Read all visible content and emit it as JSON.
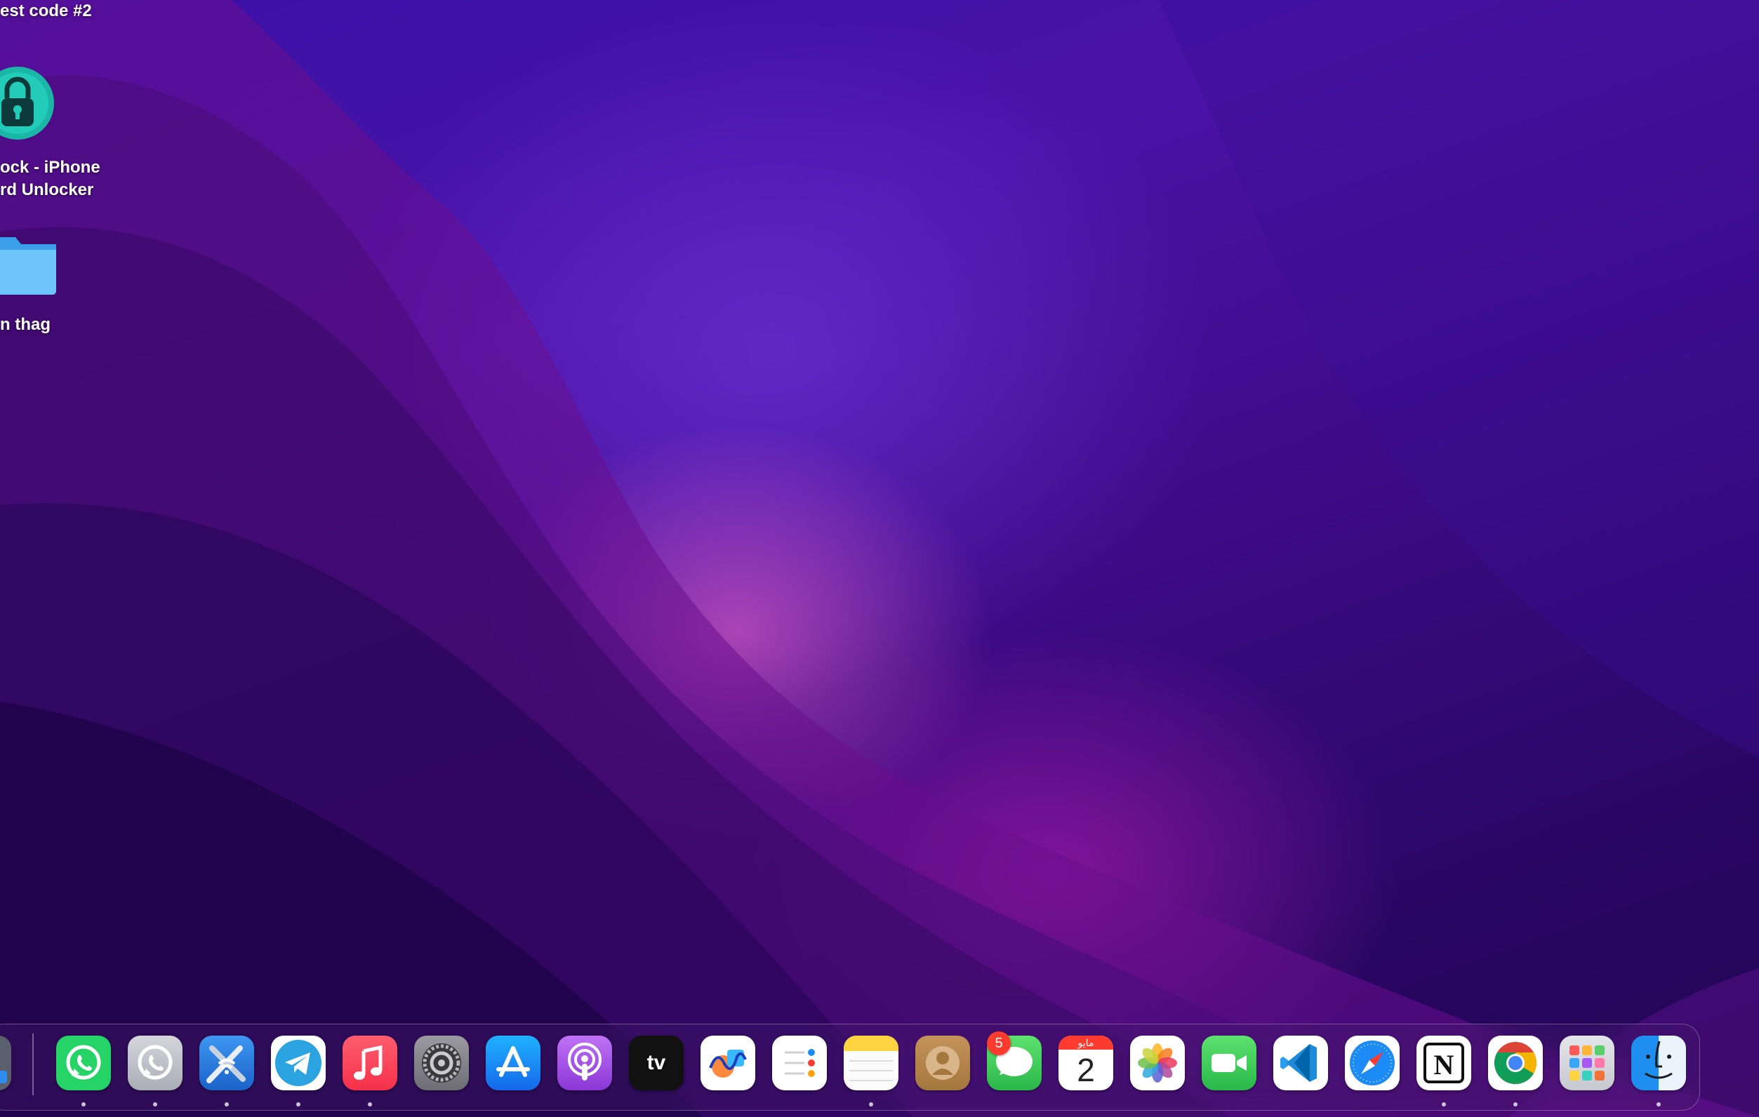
{
  "desktop": {
    "items": [
      {
        "label": "est code #2"
      },
      {
        "label_line1": "ock - iPhone",
        "label_line2": "rd Unlocker"
      },
      {
        "label": "n thag"
      }
    ]
  },
  "dock": {
    "apps": [
      {
        "name": "whatsapp-icon",
        "color": "#25D366",
        "running": true
      },
      {
        "name": "whatsapp-beta-icon",
        "color": "#B9BCC3",
        "running": true
      },
      {
        "name": "wireless-diagnostics-icon",
        "color": "#2A7BE0",
        "running": true
      },
      {
        "name": "telegram-icon",
        "color": "#2AA3E0",
        "running": true
      },
      {
        "name": "music-icon",
        "color": "#FA3C4E",
        "running": true
      },
      {
        "name": "system-settings-icon",
        "color": "#8E8E93",
        "running": false
      },
      {
        "name": "app-store-icon",
        "color": "#1C8BF5",
        "running": false
      },
      {
        "name": "podcasts-icon",
        "color": "#A251E6",
        "running": false
      },
      {
        "name": "apple-tv-icon",
        "color": "#111111",
        "running": false,
        "text": "tv"
      },
      {
        "name": "freeform-icon",
        "color": "#FFFFFF",
        "running": false
      },
      {
        "name": "reminders-icon",
        "color": "#FFFFFF",
        "running": false
      },
      {
        "name": "notes-icon",
        "color": "#FFD23F",
        "running": true
      },
      {
        "name": "contacts-icon",
        "color": "#B8874F",
        "running": false
      },
      {
        "name": "messages-icon",
        "color": "#34C759",
        "running": false,
        "badge": "5"
      },
      {
        "name": "calendar-icon",
        "color": "#FFFFFF",
        "running": false,
        "month": "مايو",
        "day": "2"
      },
      {
        "name": "photos-icon",
        "color": "#FFFFFF",
        "running": false
      },
      {
        "name": "facetime-icon",
        "color": "#34C759",
        "running": false
      },
      {
        "name": "vscode-icon",
        "color": "#FFFFFF",
        "running": false
      },
      {
        "name": "safari-icon",
        "color": "#FFFFFF",
        "running": false
      },
      {
        "name": "notion-icon",
        "color": "#FFFFFF",
        "running": true,
        "text": "N"
      },
      {
        "name": "chrome-icon",
        "color": "#FFFFFF",
        "running": true
      },
      {
        "name": "launchpad-icon",
        "color": "#D8D9DE",
        "running": false
      },
      {
        "name": "finder-icon",
        "color": "#3AA5F5",
        "running": true
      }
    ]
  }
}
